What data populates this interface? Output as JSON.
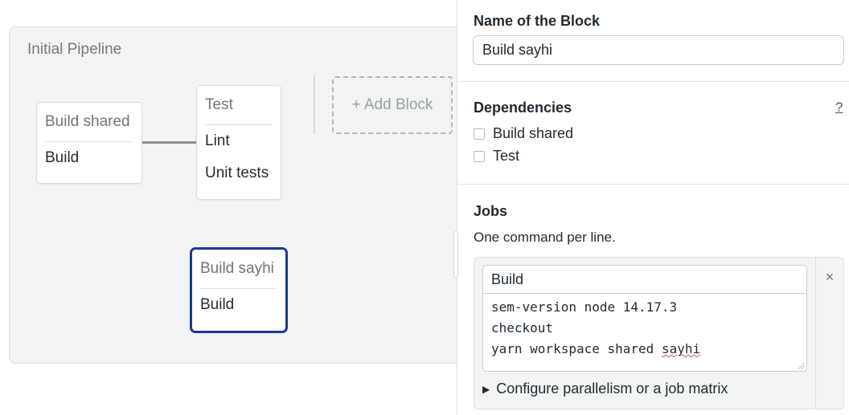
{
  "pipeline": {
    "title": "Initial Pipeline",
    "add_block_label": "+ Add Block",
    "blocks": [
      {
        "title": "Build shared",
        "jobs": [
          "Build"
        ]
      },
      {
        "title": "Test",
        "jobs": [
          "Lint",
          "Unit tests"
        ]
      },
      {
        "title": "Build sayhi",
        "jobs": [
          "Build"
        ],
        "selected": true
      }
    ]
  },
  "panel": {
    "name_section": {
      "title": "Name of the Block",
      "value": "Build sayhi"
    },
    "dependencies": {
      "title": "Dependencies",
      "help": "?",
      "items": [
        {
          "label": "Build shared",
          "checked": false
        },
        {
          "label": "Test",
          "checked": false
        }
      ]
    },
    "jobs": {
      "title": "Jobs",
      "help_text": "One command per line.",
      "job": {
        "name": "Build",
        "commands": [
          "sem-version node 14.17.3",
          "checkout",
          "yarn workspace shared",
          "sayhi"
        ],
        "close": "×"
      },
      "config_toggle": "Configure parallelism or a job matrix"
    }
  },
  "icons": {
    "close": "close-icon",
    "expand": "triangle-right-icon"
  },
  "colors": {
    "selected_border": "#1a3a8c",
    "canvas_bg": "#f3f4f4"
  }
}
